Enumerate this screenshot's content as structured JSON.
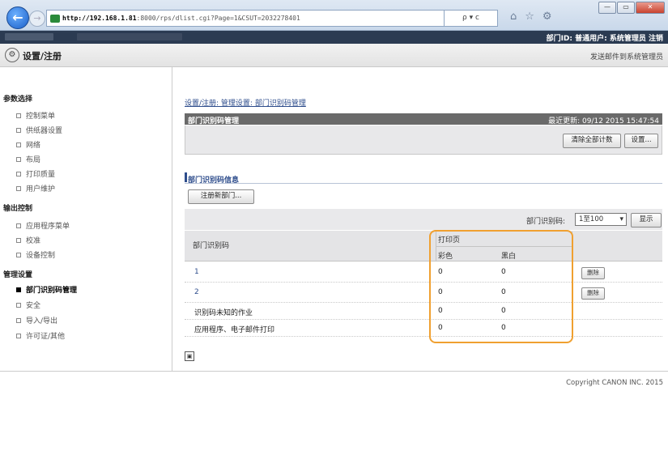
{
  "browser": {
    "url_host": "http://192.168.1.81",
    "url_rest": ":8000/rps/dlist.cgi?Page=1&CSUT=2032278401",
    "addr_tools": "ρ ▾ c",
    "window_buttons": {
      "minimize": "—",
      "maximize": "▭",
      "close": "✕"
    }
  },
  "topbar": {
    "user_info": "部门ID: 普通用户: 系统管理员 注销"
  },
  "header": {
    "title": "设置/注册",
    "mail_link": "发送邮件到系统管理员",
    "icon": "gear-icon"
  },
  "sidebar": {
    "sections": [
      {
        "heading": "参数选择",
        "items": [
          "控制菜单",
          "供纸器设置",
          "网络",
          "布局",
          "打印质量",
          "用户维护"
        ]
      },
      {
        "heading": "输出控制",
        "items": [
          "应用程序菜单",
          "校准",
          "设备控制"
        ]
      },
      {
        "heading": "管理设置",
        "items": [
          "部门识别码管理",
          "安全",
          "导入/导出",
          "许可证/其他"
        ]
      }
    ],
    "active_item": "部门识别码管理"
  },
  "main": {
    "breadcrumb": "设置/注册: 管理设置: 部门识别码管理",
    "section_title": "部门识别码管理",
    "last_updated": "最近更新: 09/12 2015 15:47:54",
    "clear_all_counts": "清除全部计数",
    "settings_button": "设置...",
    "sub_title": "部门识别码信息",
    "register_button": "注册新部门...",
    "dept_count_label": "部门识别码:",
    "page_select_value": "1至100",
    "display_button": "显示",
    "table": {
      "col_name": "部门识别码",
      "col_print": "打印页",
      "col_color": "彩色",
      "col_bw": "黑白",
      "rows": [
        {
          "name": "1",
          "color": "0",
          "bw": "0",
          "action": "删除",
          "is_link": true
        },
        {
          "name": "2",
          "color": "0",
          "bw": "0",
          "action": "删除",
          "is_link": true
        },
        {
          "name": "识别码未知的作业",
          "color": "0",
          "bw": "0",
          "action": "",
          "is_link": false
        },
        {
          "name": "应用程序、电子邮件打印",
          "color": "0",
          "bw": "0",
          "action": "",
          "is_link": false
        }
      ]
    },
    "collapse_icon": "▣"
  },
  "footer": {
    "copyright": "Copyright CANON INC. 2015"
  },
  "colors": {
    "highlight": "#f0a030",
    "header_bar": "#2b3b52",
    "section_header": "#6a6a6a",
    "link": "#2e4d8c"
  }
}
